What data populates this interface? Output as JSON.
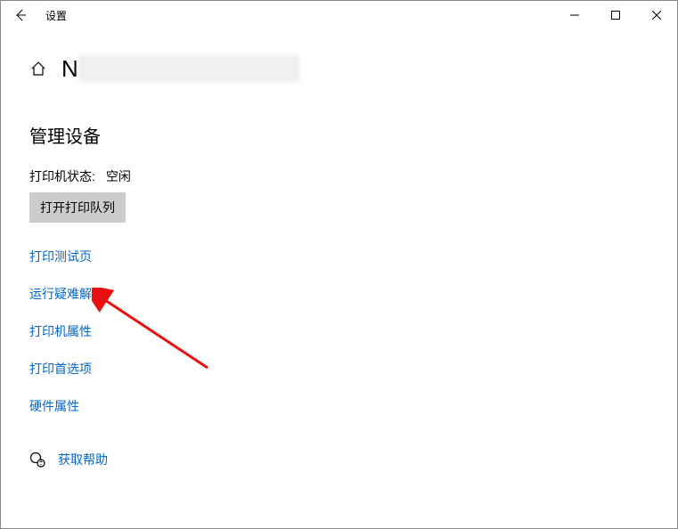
{
  "titlebar": {
    "title": "设置"
  },
  "header": {
    "device_name_prefix": "N"
  },
  "section": {
    "title": "管理设备"
  },
  "status": {
    "label": "打印机状态:",
    "value": "空闲"
  },
  "buttons": {
    "open_queue": "打开打印队列"
  },
  "links": {
    "print_test_page": "打印测试页",
    "troubleshoot": "运行疑难解答",
    "printer_properties": "打印机属性",
    "printing_preferences": "打印首选项",
    "hardware_properties": "硬件属性",
    "get_help": "获取帮助"
  }
}
